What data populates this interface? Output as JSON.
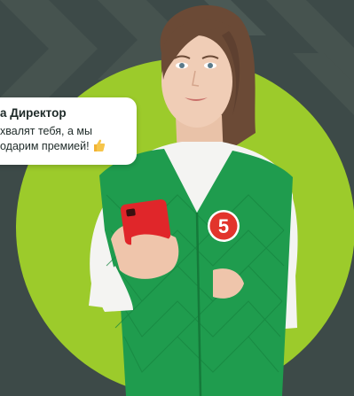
{
  "bubble": {
    "title": "а Директор",
    "line1": "хвалят тебя, а мы",
    "line2": "одарим премией!",
    "emoji_icon": "thumbs-up-icon"
  },
  "badge": {
    "text": "5"
  },
  "colors": {
    "background": "#3d4a48",
    "circle": "#9ccb2b",
    "vest": "#1f9c4e",
    "phone": "#e0262a",
    "badge": "#e2342c",
    "shirt": "#f4f4f2"
  }
}
